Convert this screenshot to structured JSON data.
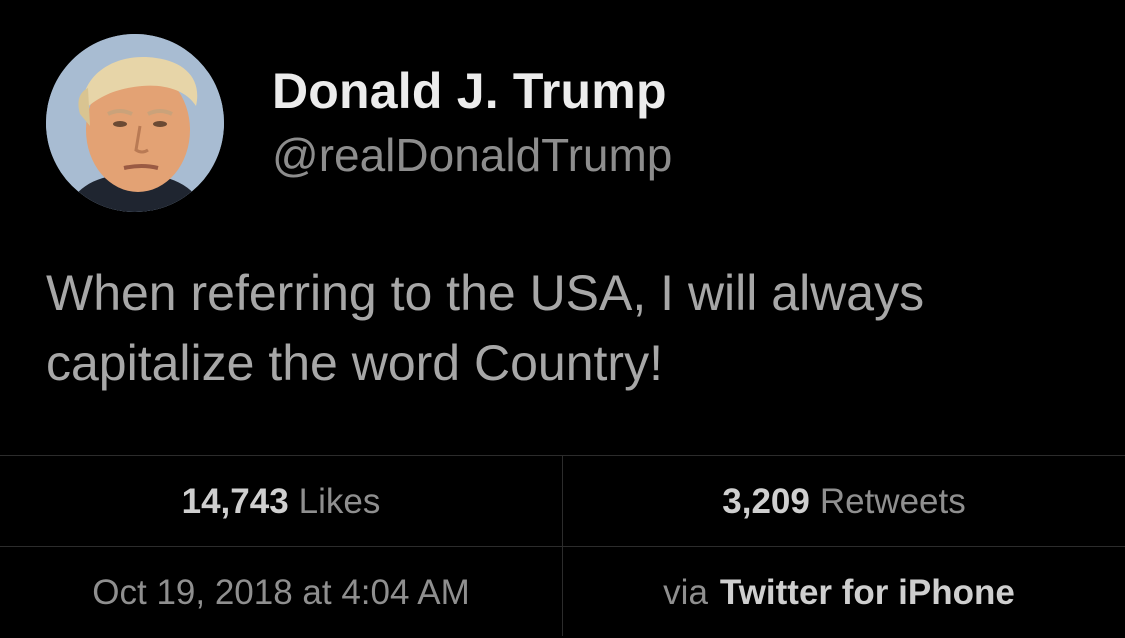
{
  "user": {
    "display_name": "Donald J. Trump",
    "handle": "@realDonaldTrump"
  },
  "tweet": {
    "text": "When referring to the USA, I will always capitalize the word Country!"
  },
  "stats": {
    "likes_count": "14,743",
    "likes_label": "Likes",
    "retweets_count": "3,209",
    "retweets_label": "Retweets",
    "timestamp": "Oct 19, 2018 at 4:04 AM",
    "via_label": "via",
    "source": "Twitter for iPhone"
  },
  "colors": {
    "background": "#000000",
    "name": "#ececec",
    "secondary": "#8d8d8d",
    "divider": "#2c2c2c"
  }
}
